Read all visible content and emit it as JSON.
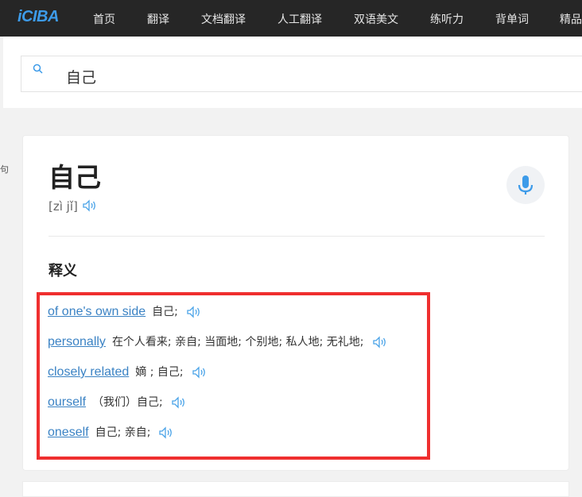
{
  "header": {
    "logo": "iCIBA",
    "nav": [
      "首页",
      "翻译",
      "文档翻译",
      "人工翻译",
      "双语美文",
      "练听力",
      "背单词",
      "精品"
    ]
  },
  "search": {
    "value": "自己",
    "icon": "search-icon"
  },
  "left_fragment": "句",
  "entry": {
    "word": "自己",
    "pronunciation": "[zì jǐ]",
    "section_title": "释义",
    "definitions": [
      {
        "term": "of one's own side",
        "meaning": "自己;"
      },
      {
        "term": "personally",
        "meaning": "在个人看来; 亲自; 当面地; 个别地; 私人地; 无礼地;"
      },
      {
        "term": "closely related",
        "meaning": "嫡 ; 自己;"
      },
      {
        "term": "ourself",
        "meaning": "（我们）自己;"
      },
      {
        "term": "oneself",
        "meaning": "自己; 亲自;"
      }
    ]
  },
  "colors": {
    "accent": "#3d9be9",
    "link": "#3a82c4",
    "highlight": "#ef2f2f",
    "topbar": "#262626"
  }
}
